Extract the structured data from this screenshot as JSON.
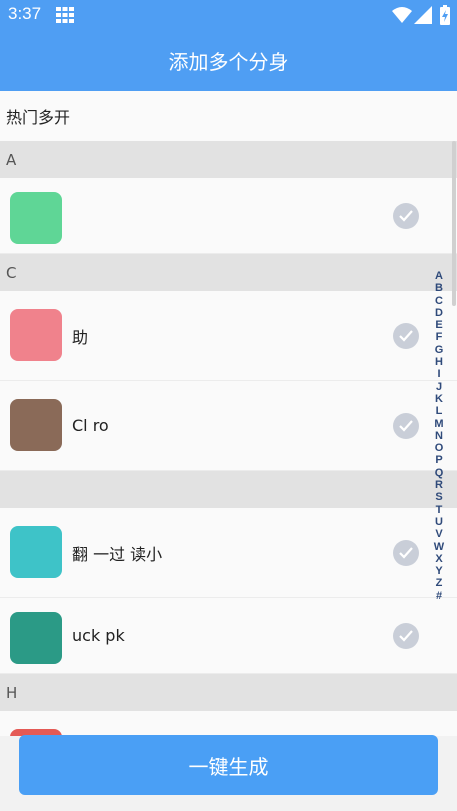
{
  "status": {
    "time": "3:37"
  },
  "header": {
    "title": "添加多个分身"
  },
  "hot_label": "热门多开",
  "sections": [
    {
      "letter": "A",
      "items": [
        {
          "name": "",
          "icon_color": "#5fd696",
          "selected": true
        }
      ]
    },
    {
      "letter": "C",
      "items": [
        {
          "name": "助",
          "icon_color": "#f0828c",
          "selected": true
        },
        {
          "name": "Cl ro",
          "icon_color": "#8a6a58",
          "selected": true
        }
      ]
    },
    {
      "letter": "",
      "items": [
        {
          "name": "翻 一过 读小",
          "icon_color": "#3ec3c8",
          "selected": true
        },
        {
          "name": "uck pk",
          "icon_color": "#2b9a86",
          "selected": true
        }
      ]
    },
    {
      "letter": "H",
      "items": [
        {
          "name": "",
          "icon_color": "#e45a55",
          "selected": true
        }
      ]
    }
  ],
  "index_letters": [
    "A",
    "B",
    "C",
    "D",
    "E",
    "F",
    "G",
    "H",
    "I",
    "J",
    "K",
    "L",
    "M",
    "N",
    "O",
    "P",
    "Q",
    "R",
    "S",
    "T",
    "U",
    "V",
    "W",
    "X",
    "Y",
    "Z",
    "#"
  ],
  "footer": {
    "generate_label": "一键生成"
  },
  "colors": {
    "primary": "#4f9ef3",
    "check": "#c9ced8"
  }
}
